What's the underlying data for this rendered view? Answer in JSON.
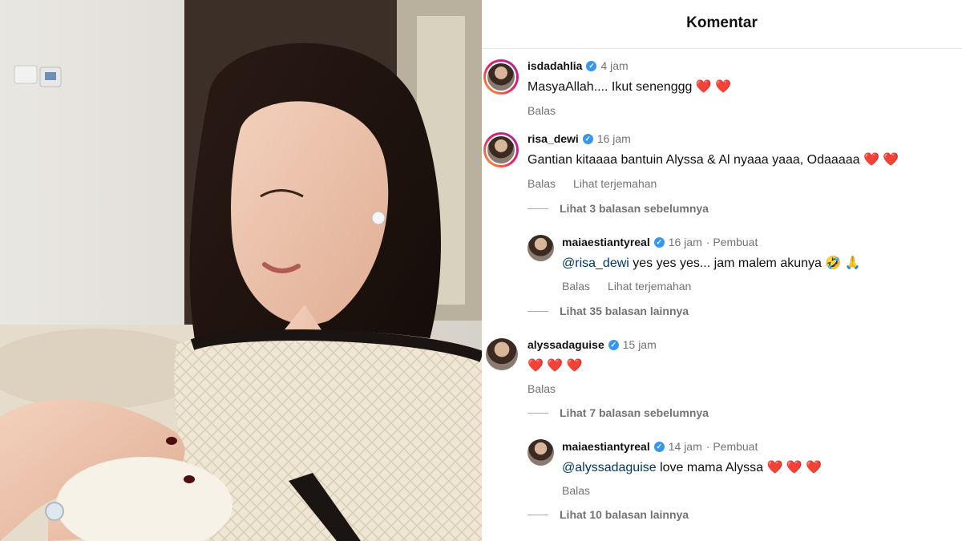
{
  "header": {
    "title": "Komentar"
  },
  "comments": [
    {
      "username": "isdadahlia",
      "time": "4 jam",
      "text": "MasyaAllah.... Ikut senenggg ❤️ ❤️",
      "reply": "Balas"
    },
    {
      "username": "risa_dewi",
      "time": "16 jam",
      "text": "Gantian kitaaaa bantuin Alyssa & Al nyaaa yaaa, Odaaaaa ❤️ ❤️",
      "reply": "Balas",
      "translate": "Lihat terjemahan",
      "prev_replies": "Lihat 3 balasan sebelumnya",
      "reply_item": {
        "username": "maiaestiantyreal",
        "time": "16 jam",
        "creator": "· Pembuat",
        "mention": "@risa_dewi",
        "text": " yes yes yes... jam malem akunya 🤣 🙏",
        "reply": "Balas",
        "translate": "Lihat terjemahan"
      },
      "more_replies": "Lihat 35 balasan lainnya"
    },
    {
      "username": "alyssadaguise",
      "time": "15 jam",
      "text": "❤️ ❤️ ❤️",
      "reply": "Balas",
      "prev_replies": "Lihat 7 balasan sebelumnya",
      "reply_item": {
        "username": "maiaestiantyreal",
        "time": "14 jam",
        "creator": "· Pembuat",
        "mention": "@alyssadaguise",
        "text": " love mama Alyssa ❤️ ❤️ ❤️",
        "reply": "Balas"
      },
      "more_replies": "Lihat 10 balasan lainnya"
    }
  ],
  "icons": {
    "verified": "verified-badge-icon"
  },
  "colors": {
    "link": "#00376b",
    "verified": "#3797f0",
    "muted": "#737373"
  }
}
